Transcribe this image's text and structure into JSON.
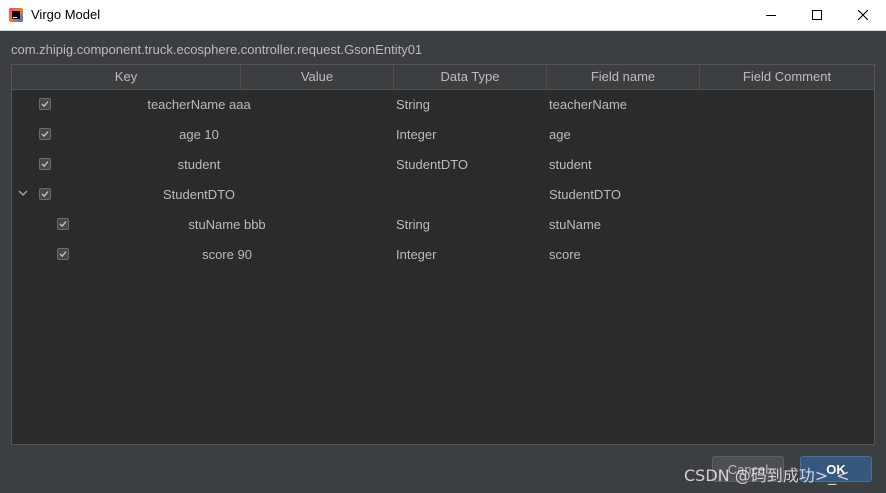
{
  "window": {
    "title": "Virgo Model"
  },
  "class_path": "com.zhipig.component.truck.ecosphere.controller.request.GsonEntity01",
  "table": {
    "headers": {
      "key": "Key",
      "value": "Value",
      "data_type": "Data Type",
      "field_name": "Field name",
      "field_comment": "Field Comment"
    },
    "rows": [
      {
        "key": "teacherName aaa",
        "data_type": "String",
        "field_name": "teacherName",
        "checked": true
      },
      {
        "key": "age 10",
        "data_type": "Integer",
        "field_name": "age",
        "checked": true
      },
      {
        "key": "student",
        "data_type": "StudentDTO",
        "field_name": "student",
        "checked": true
      },
      {
        "key": "StudentDTO",
        "data_type": "",
        "field_name": "StudentDTO",
        "checked": true,
        "expanded": true
      },
      {
        "key": "stuName bbb",
        "data_type": "String",
        "field_name": "stuName",
        "checked": true
      },
      {
        "key": "score 90",
        "data_type": "Integer",
        "field_name": "score",
        "checked": true
      }
    ]
  },
  "buttons": {
    "cancel": "Cancel",
    "ok": "OK"
  },
  "watermark": "CSDN @码到成功>_<",
  "colors": {
    "background": "#3c3f41",
    "table_bg": "#2b2b2b",
    "text": "#bbbbbb",
    "ok_button": "#365880"
  },
  "icons": {
    "app": "intellij-idea-icon",
    "minimize": "minimize-icon",
    "maximize": "maximize-icon",
    "close": "close-icon",
    "checkbox": "checkmark-icon",
    "expand": "chevron-down-icon"
  }
}
